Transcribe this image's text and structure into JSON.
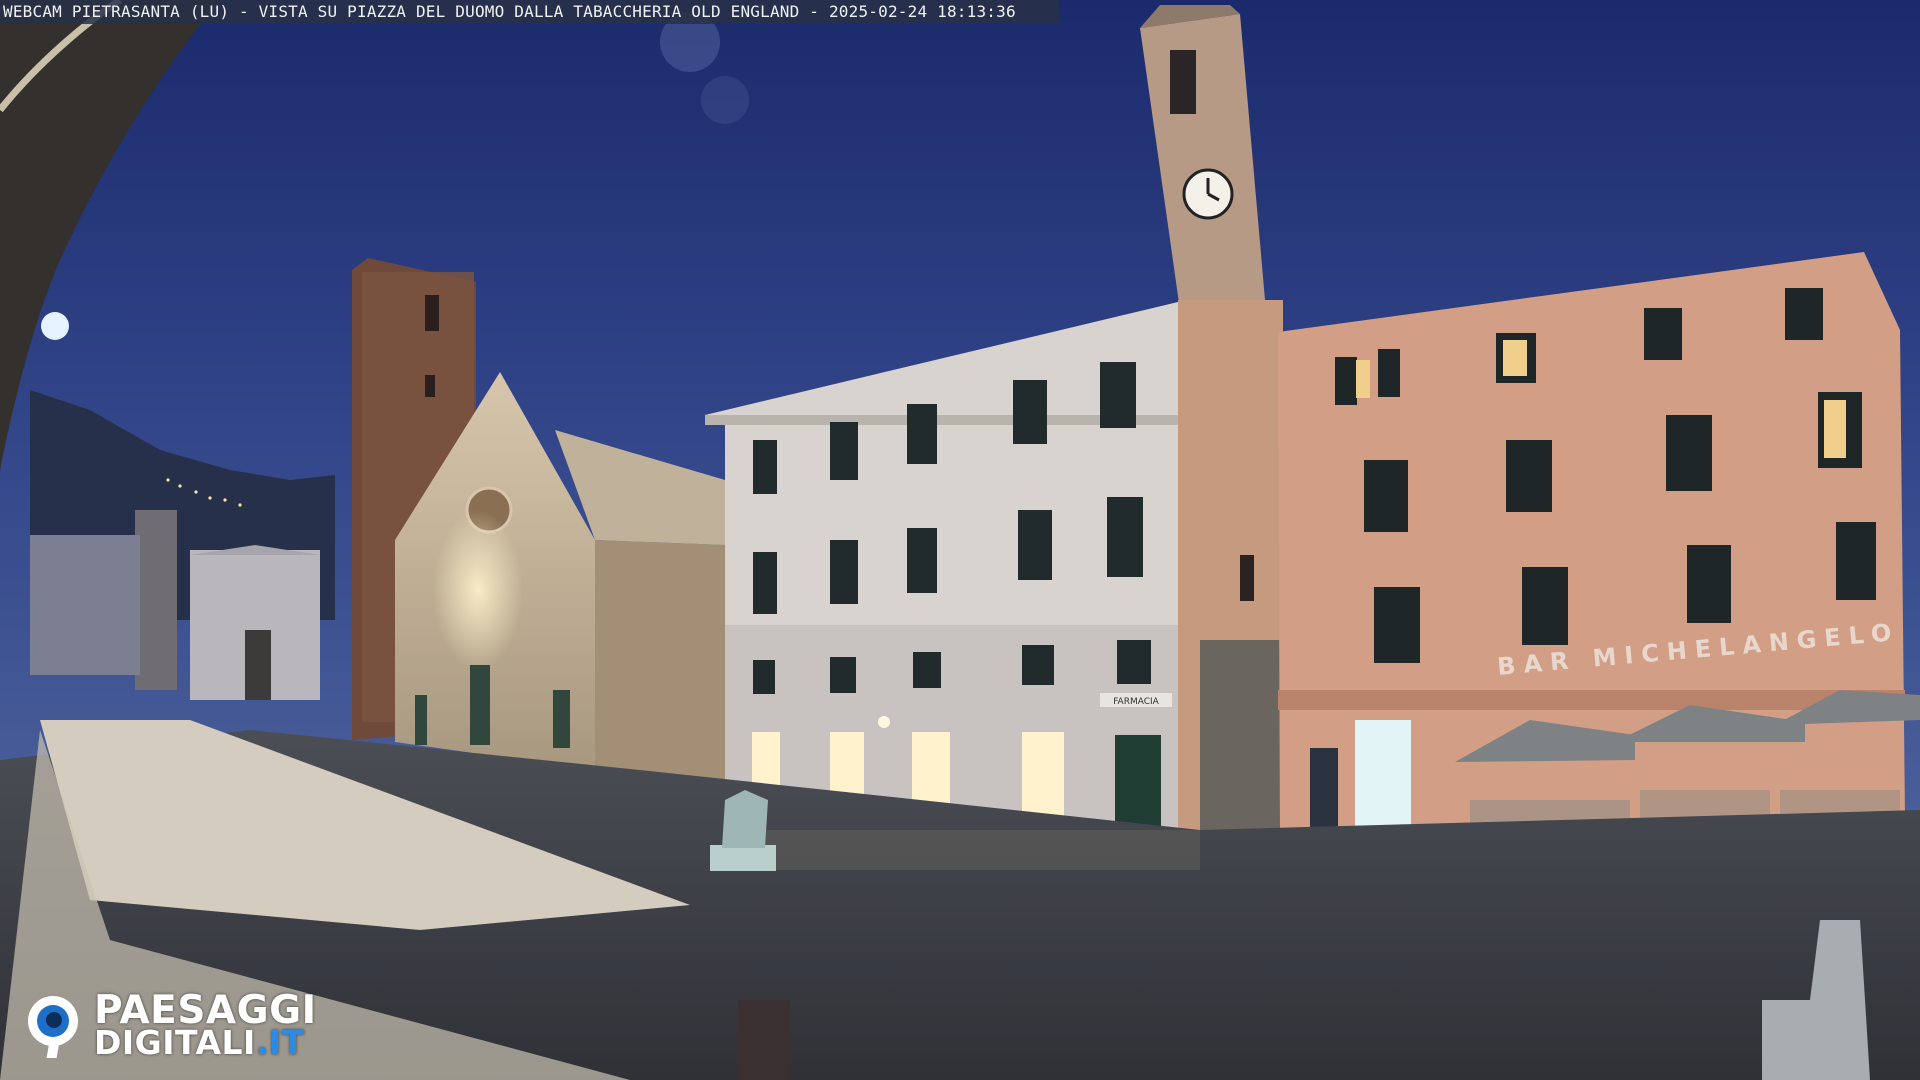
{
  "caption": {
    "text": "WEBCAM PIETRASANTA (LU) - VISTA SU PIAZZA DEL DUOMO DALLA TABACCHERIA OLD ENGLAND - 2025-02-24 18:13:36"
  },
  "scene": {
    "sign_bar": "BAR MICHELANGELO",
    "shop_sign": "FARMACIA",
    "clock_time": "18:13"
  },
  "logo": {
    "line1": "PAESAGGI",
    "line2": "DIGITALI",
    "tld": ".IT",
    "brand_color": "#2a8be8",
    "icon": "eye-logo-icon"
  },
  "colors": {
    "sky_top": "#1d2a6a",
    "sky_bottom": "#3a4e8e",
    "building_cream": "#d9d2cc",
    "building_pink": "#d39e86",
    "shop_light": "#fff2cc",
    "piazza": "#3a3d44"
  }
}
